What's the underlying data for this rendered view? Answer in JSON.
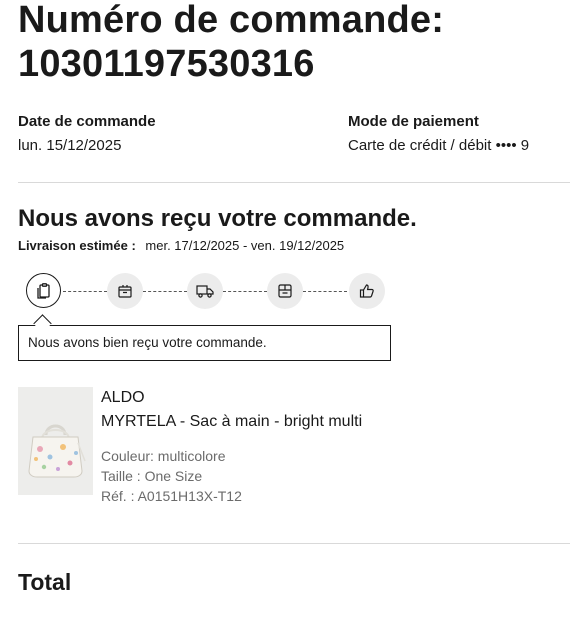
{
  "order": {
    "title_prefix": "Numéro de commande:",
    "number": "10301197530316"
  },
  "meta": {
    "date_label": "Date de commande",
    "date_value": "lun. 15/12/2025",
    "payment_label": "Mode de paiement",
    "payment_value": "Carte de crédit / débit •••• 9"
  },
  "status": {
    "title": "Nous avons reçu votre commande.",
    "delivery_label": "Livraison estimée :",
    "delivery_value": "mer. 17/12/2025 - ven. 19/12/2025",
    "message": "Nous avons bien reçu votre commande.",
    "steps": [
      {
        "icon": "clipboard-icon",
        "active": true
      },
      {
        "icon": "package-icon",
        "active": false
      },
      {
        "icon": "truck-icon",
        "active": false
      },
      {
        "icon": "parcel-icon",
        "active": false
      },
      {
        "icon": "thumbs-up-icon",
        "active": false
      }
    ]
  },
  "product": {
    "brand": "ALDO",
    "name": "MYRTELA - Sac à main - bright multi",
    "color": "Couleur: multicolore",
    "size": "Taille : One Size",
    "ref": "Réf. : A0151H13X-T12"
  },
  "summary": {
    "total_label": "Total"
  }
}
